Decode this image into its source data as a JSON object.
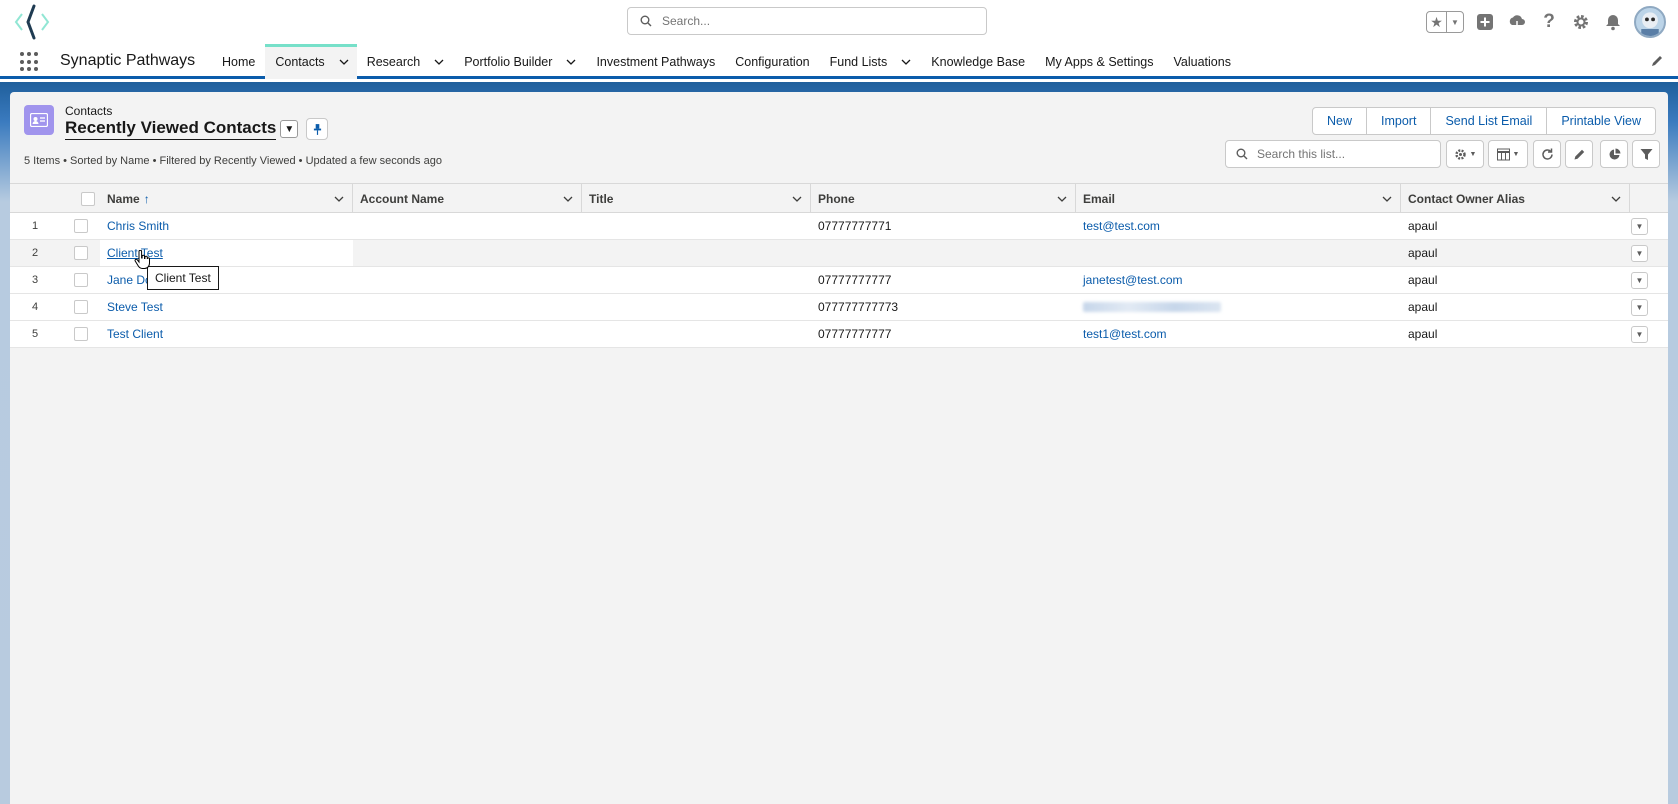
{
  "global_search": {
    "placeholder": "Search..."
  },
  "app": {
    "name": "Synaptic Pathways"
  },
  "nav": {
    "items": [
      {
        "label": "Home",
        "has_menu": false
      },
      {
        "label": "Contacts",
        "has_menu": true,
        "active": true
      },
      {
        "label": "Research",
        "has_menu": true
      },
      {
        "label": "Portfolio Builder",
        "has_menu": true
      },
      {
        "label": "Investment Pathways",
        "has_menu": false
      },
      {
        "label": "Configuration",
        "has_menu": false
      },
      {
        "label": "Fund Lists",
        "has_menu": true
      },
      {
        "label": "Knowledge Base",
        "has_menu": false
      },
      {
        "label": "My Apps & Settings",
        "has_menu": false
      },
      {
        "label": "Valuations",
        "has_menu": false
      }
    ]
  },
  "list_view": {
    "object_label": "Contacts",
    "title": "Recently Viewed Contacts",
    "info": "5 Items • Sorted by Name • Filtered by Recently Viewed • Updated a few seconds ago",
    "buttons": {
      "new": "New",
      "import": "Import",
      "send_list_email": "Send List Email",
      "printable_view": "Printable View"
    },
    "search_placeholder": "Search this list..."
  },
  "table": {
    "columns": {
      "name": "Name",
      "account_name": "Account Name",
      "title": "Title",
      "phone": "Phone",
      "email": "Email",
      "owner_alias": "Contact Owner Alias"
    },
    "sort_indicator": "↑",
    "rows": [
      {
        "num": "1",
        "name": "Chris Smith",
        "account": "",
        "title": "",
        "phone": "07777777771",
        "email": "test@test.com",
        "owner": "apaul"
      },
      {
        "num": "2",
        "name": "Client Test",
        "account": "",
        "title": "",
        "phone": "",
        "email": "",
        "owner": "apaul"
      },
      {
        "num": "3",
        "name": "Jane Doe",
        "account": "",
        "title": "",
        "phone": "07777777777",
        "email": "janetest@test.com",
        "owner": "apaul"
      },
      {
        "num": "4",
        "name": "Steve Test",
        "account": "",
        "title": "",
        "phone": "077777777773",
        "email": "",
        "email_blurred": true,
        "owner": "apaul"
      },
      {
        "num": "5",
        "name": "Test Client",
        "account": "",
        "title": "",
        "phone": "07777777777",
        "email": "test1@test.com",
        "owner": "apaul"
      }
    ]
  },
  "tooltip": {
    "text": "Client Test"
  },
  "colors": {
    "brand_blue": "#0b5cab",
    "contact_icon": "#a094ed",
    "active_tab_accent": "#76e0c9"
  }
}
